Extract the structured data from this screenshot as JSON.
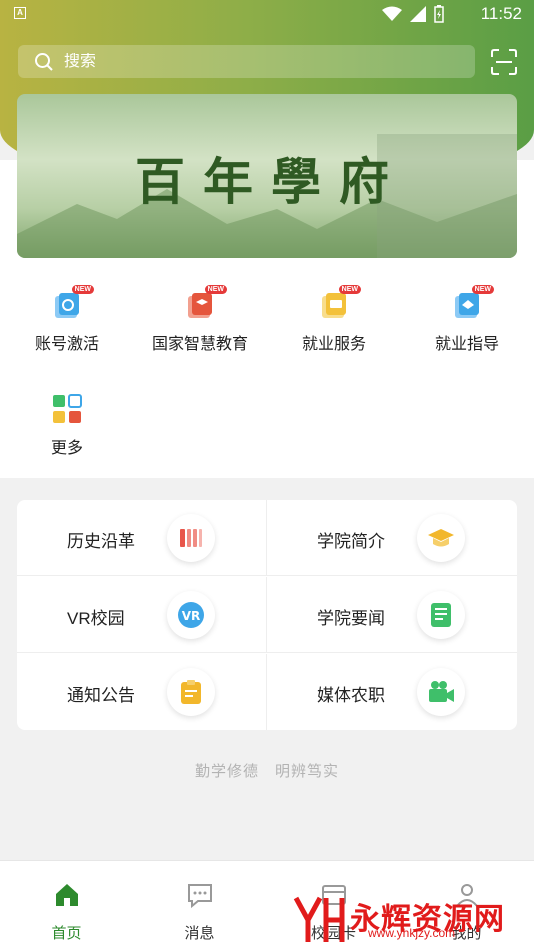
{
  "statusbar": {
    "time": "11:52",
    "sim_label": "A"
  },
  "search": {
    "placeholder": "搜索"
  },
  "banner": {
    "title": "百年學府"
  },
  "services": [
    {
      "label": "账号激活",
      "badge": "NEW",
      "color": "#3ea6e8"
    },
    {
      "label": "国家智慧教育",
      "badge": "NEW",
      "color": "#e5553c"
    },
    {
      "label": "就业服务",
      "badge": "NEW",
      "color": "#f3c13a"
    },
    {
      "label": "就业指导",
      "badge": "NEW",
      "color": "#3ea6e8"
    },
    {
      "label": "更多",
      "badge": "",
      "color": "#3fbf6a"
    }
  ],
  "links": [
    {
      "label": "历史沿革",
      "icon": "history-icon",
      "color": "#e8554a"
    },
    {
      "label": "学院简介",
      "icon": "graduation-cap-icon",
      "color": "#f2b72b"
    },
    {
      "label": "VR校园",
      "icon": "vr-icon",
      "color": "#3ea6e8"
    },
    {
      "label": "学院要闻",
      "icon": "news-icon",
      "color": "#3fbf6a"
    },
    {
      "label": "通知公告",
      "icon": "notice-icon",
      "color": "#f2b72b"
    },
    {
      "label": "媒体农职",
      "icon": "video-camera-icon",
      "color": "#3fbf6a"
    }
  ],
  "motto": {
    "left": "勤学修德",
    "right": "明辨笃实"
  },
  "tabs": [
    {
      "label": "首页",
      "icon": "home-icon",
      "active": true
    },
    {
      "label": "消息",
      "icon": "message-icon",
      "active": false
    },
    {
      "label": "校园卡",
      "icon": "card-icon",
      "active": false
    },
    {
      "label": "我的",
      "icon": "user-icon",
      "active": false
    }
  ],
  "watermark": {
    "title": "永辉资源网",
    "url": "www.yhkjzy.com"
  },
  "colors": {
    "accent": "#2d8a2d",
    "header_left": "#b8b342",
    "header_right": "#5a9e45"
  }
}
